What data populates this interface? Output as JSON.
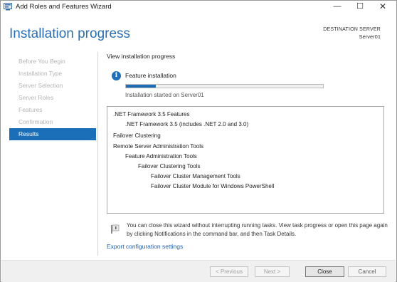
{
  "window": {
    "title": "Add Roles and Features Wizard",
    "controls": {
      "minimize": "—",
      "maximize": "☐",
      "close": "✕"
    }
  },
  "header": {
    "title": "Installation progress",
    "destination_label": "DESTINATION SERVER",
    "destination_server": "Server01"
  },
  "nav": {
    "items": [
      {
        "label": "Before You Begin",
        "active": false
      },
      {
        "label": "Installation Type",
        "active": false
      },
      {
        "label": "Server Selection",
        "active": false
      },
      {
        "label": "Server Roles",
        "active": false
      },
      {
        "label": "Features",
        "active": false
      },
      {
        "label": "Confirmation",
        "active": false
      },
      {
        "label": "Results",
        "active": true
      }
    ]
  },
  "main": {
    "section_title": "View installation progress",
    "status_label": "Feature installation",
    "progress_fraction": 0.15,
    "started_text": "Installation started on Server01",
    "results": [
      {
        "text": ".NET Framework 3.5 Features",
        "level": 0
      },
      {
        "text": ".NET Framework 3.5 (includes .NET 2.0 and 3.0)",
        "level": 1
      },
      {
        "text": "Failover Clustering",
        "level": 0
      },
      {
        "text": "Remote Server Administration Tools",
        "level": 0
      },
      {
        "text": "Feature Administration Tools",
        "level": 1
      },
      {
        "text": "Failover Clustering Tools",
        "level": 2
      },
      {
        "text": "Failover Cluster Management Tools",
        "level": 3
      },
      {
        "text": "Failover Cluster Module for Windows PowerShell",
        "level": 3
      }
    ],
    "note_text": "You can close this wizard without interrupting running tasks. View task progress or open this page again by clicking Notifications in the command bar, and then Task Details.",
    "export_link": "Export configuration settings"
  },
  "footer": {
    "previous": "< Previous",
    "next": "Next >",
    "close": "Close",
    "cancel": "Cancel"
  },
  "colors": {
    "accent": "#1a6fb8",
    "title_blue": "#2a6fb4",
    "link": "#1f5fa8"
  },
  "icons": {
    "app": "server-manager-icon",
    "status": "info-icon",
    "note": "notification-flag-icon"
  }
}
